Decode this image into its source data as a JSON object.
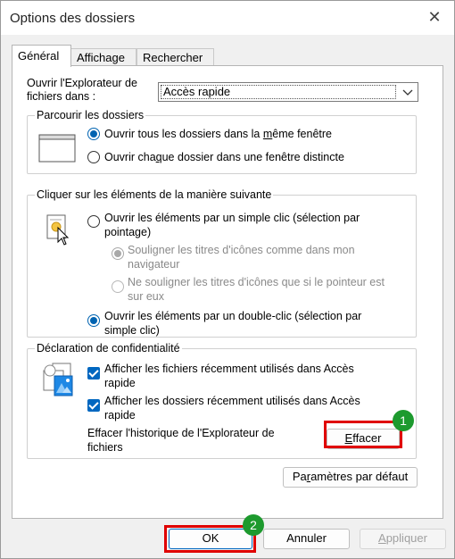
{
  "window": {
    "title": "Options des dossiers",
    "close_glyph": "✕"
  },
  "tabs": [
    {
      "label": "Général",
      "active": true
    },
    {
      "label": "Affichage",
      "active": false
    },
    {
      "label": "Rechercher",
      "active": false
    }
  ],
  "open_explorer": {
    "label_line1": "Ouvrir l'Explorateur de",
    "label_line2": "fichiers dans :",
    "selected": "Accès rapide"
  },
  "browse": {
    "title": "Parcourir les dossiers",
    "option1": {
      "before": "Ouvrir tous les dossiers dans la ",
      "underlined": "m",
      "after": "ême fenêtre",
      "checked": true
    },
    "option2": {
      "before": "Ouvrir cha",
      "underlined": "q",
      "after": "ue dossier dans une fenêtre distincte",
      "checked": false
    }
  },
  "click": {
    "title": "Cliquer sur les éléments de la manière suivante",
    "single": {
      "line1": "Ouvrir les éléments par un simple clic (sélection par",
      "line2": "pointage)",
      "checked": false
    },
    "underline_browser": {
      "line1": "Souligner les titres d'icônes comme dans mon",
      "line2": "navigateur",
      "checked": true,
      "disabled": true
    },
    "underline_point": {
      "line1": "Ne souligner les titres d'icônes que si le pointeur est",
      "line2": "sur eux",
      "checked": false,
      "disabled": true
    },
    "double": {
      "line1": "Ouvrir les éléments par un double-clic (sélection par",
      "line2": "simple clic)",
      "checked": true
    }
  },
  "privacy": {
    "title": "Déclaration de confidentialité",
    "recent_files": {
      "line1": "Afficher les fichiers récemment utilisés dans Accès",
      "line2": "rapide",
      "checked": true
    },
    "recent_folders": {
      "line1": "Afficher les dossiers récemment utilisés dans Accès",
      "line2": "rapide",
      "checked": true
    },
    "clear_label_line1": "Effacer l'historique de l'Explorateur de",
    "clear_label_line2": "fichiers",
    "clear_button": {
      "underlined": "E",
      "rest": "ffacer"
    }
  },
  "defaults_button": {
    "before": "Pa",
    "underlined": "r",
    "after": "amètres par défaut"
  },
  "footer": {
    "ok": "OK",
    "cancel": "Annuler",
    "apply": {
      "underlined": "A",
      "rest": "ppliquer"
    }
  },
  "annotations": {
    "badge1": "1",
    "badge2": "2"
  },
  "colors": {
    "accent": "#0067c0",
    "highlight": "#e00000",
    "badge": "#1d9a2e"
  }
}
